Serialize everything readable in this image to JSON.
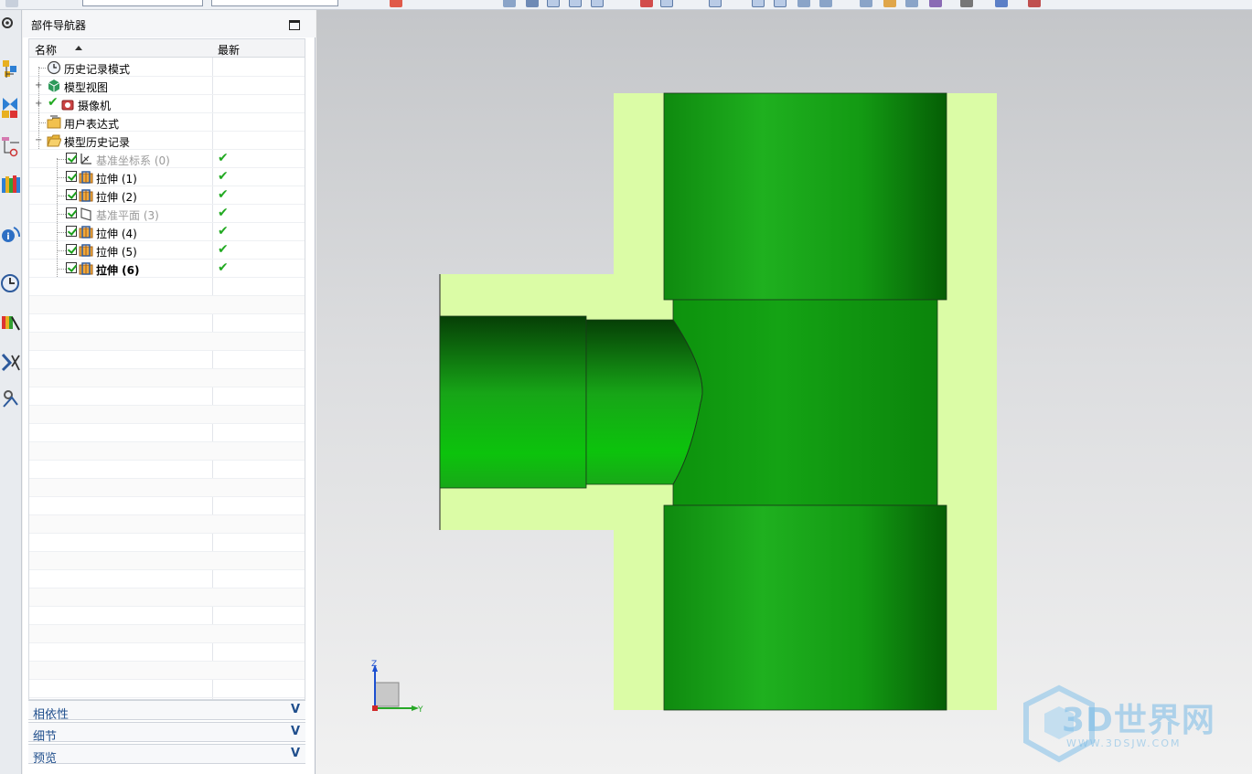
{
  "navigator": {
    "title": "部件导航器",
    "columns": {
      "name": "名称",
      "latest": "最新"
    },
    "nodes": [
      {
        "label": "历史记录模式",
        "icon": "clock-icon"
      },
      {
        "label": "模型视图",
        "icon": "model-views-icon"
      },
      {
        "label": "摄像机",
        "icon": "camera-icon"
      },
      {
        "label": "用户表达式",
        "icon": "folder-icon"
      },
      {
        "label": "模型历史记录",
        "icon": "open-folder-icon"
      }
    ],
    "features": [
      {
        "label": "基准坐标系 (0)",
        "icon": "datum-csys-icon",
        "latest": "✔"
      },
      {
        "label": "拉伸 (1)",
        "icon": "extrude-icon",
        "latest": "✔"
      },
      {
        "label": "拉伸 (2)",
        "icon": "extrude-icon",
        "latest": "✔"
      },
      {
        "label": "基准平面 (3)",
        "icon": "datum-plane-icon",
        "latest": "✔"
      },
      {
        "label": "拉伸 (4)",
        "icon": "extrude-icon",
        "latest": "✔"
      },
      {
        "label": "拉伸 (5)",
        "icon": "extrude-icon",
        "latest": "✔"
      },
      {
        "label": "拉伸 (6)",
        "icon": "extrude-icon",
        "latest": "✔"
      }
    ],
    "sections": [
      {
        "label": "相依性",
        "chevron": "V"
      },
      {
        "label": "细节",
        "chevron": "V"
      },
      {
        "label": "预览",
        "chevron": "V"
      }
    ]
  },
  "triad": {
    "z": "Z",
    "y": "Y"
  },
  "watermark": {
    "brand": "3D世界网",
    "url": "WWW.3DSJW.COM"
  },
  "colors": {
    "body_fill": "#dbfca6",
    "green": "#1aa01a",
    "check": "#22aa22",
    "section_label": "#1f4e8c"
  },
  "resource_bar_icons": [
    "settings-icon",
    "assembly-navigator-icon",
    "constraint-navigator-icon",
    "part-navigator-icon",
    "reuse-library-icon",
    "hd3d-tools-icon",
    "history-icon",
    "system-materials-icon",
    "roles-icon",
    "process-studio-icon"
  ]
}
